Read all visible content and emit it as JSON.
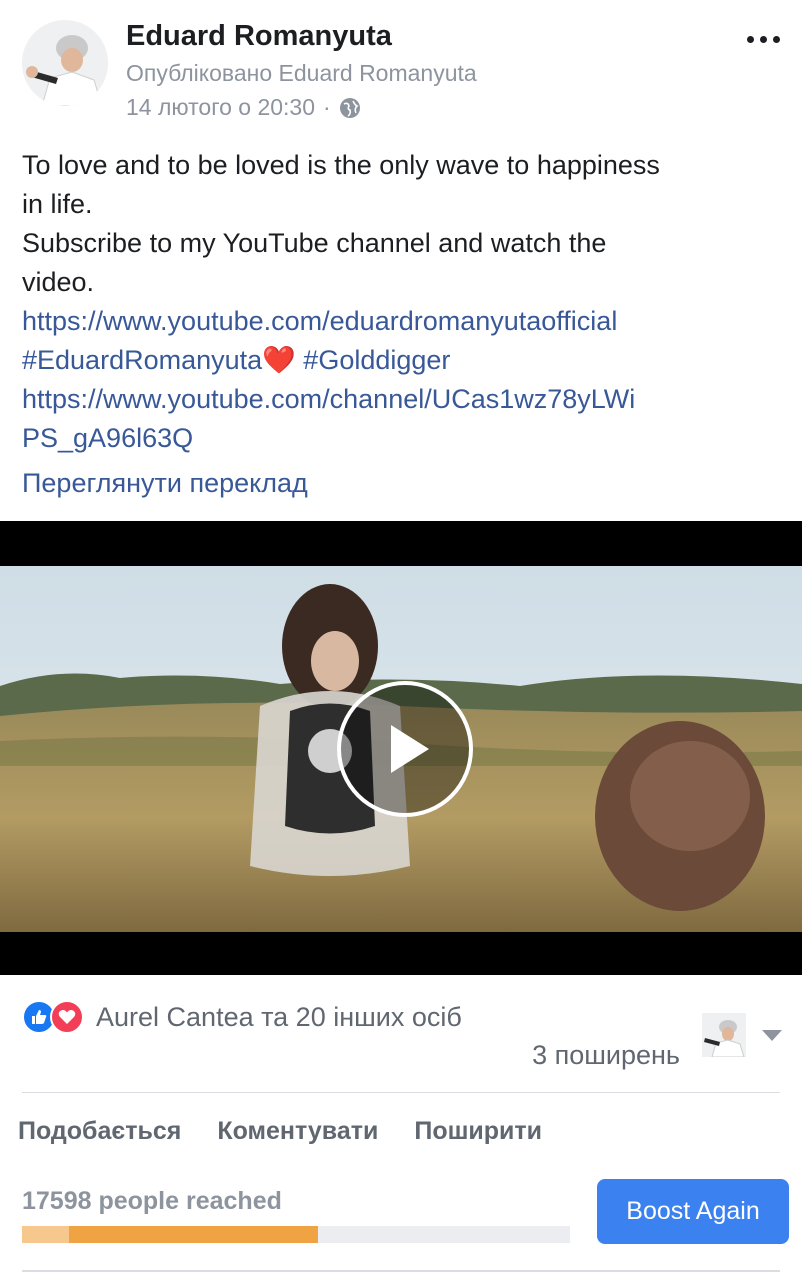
{
  "post": {
    "author": "Eduard Romanyuta",
    "published_by": "Опубліковано Eduard Romanyuta",
    "timestamp": "14 лютого о 20:30",
    "separator": "·",
    "privacy_icon": "globe-icon",
    "more_icon": "more-options-icon",
    "text_lines": [
      "To love and to be loved is the only wave to happiness",
      "in life.",
      "Subscribe to my YouTube channel and watch the",
      "video."
    ],
    "link_1": "https://www.youtube.com/eduardromanyutaofficial",
    "hashtag_1": "#EduardRomanyuta",
    "heart": "❤️",
    "hashtag_2": "#Golddigger",
    "link_2_line_1": "https://www.youtube.com/channel/UCas1wz78yLWi",
    "link_2_line_2": "PS_gA96l63Q",
    "translate": "Переглянути переклад"
  },
  "video": {
    "play_icon": "play-icon"
  },
  "engagement": {
    "reactors": "Aurel Cantea та 20 інших осіб",
    "shares": "3 поширень",
    "reaction_icons": [
      "like-reaction-icon",
      "love-reaction-icon"
    ]
  },
  "actions": {
    "like": "Подобається",
    "comment": "Коментувати",
    "share": "Поширити"
  },
  "insights": {
    "reached": "17598 people reached",
    "organic_fraction": 0.085,
    "paid_fraction": 0.54,
    "boost_label": "Boost Again"
  },
  "colors": {
    "link": "#385898",
    "boost_button": "#3b82f0",
    "bar_paid": "#f0a342",
    "bar_organic": "#f7c88e"
  }
}
